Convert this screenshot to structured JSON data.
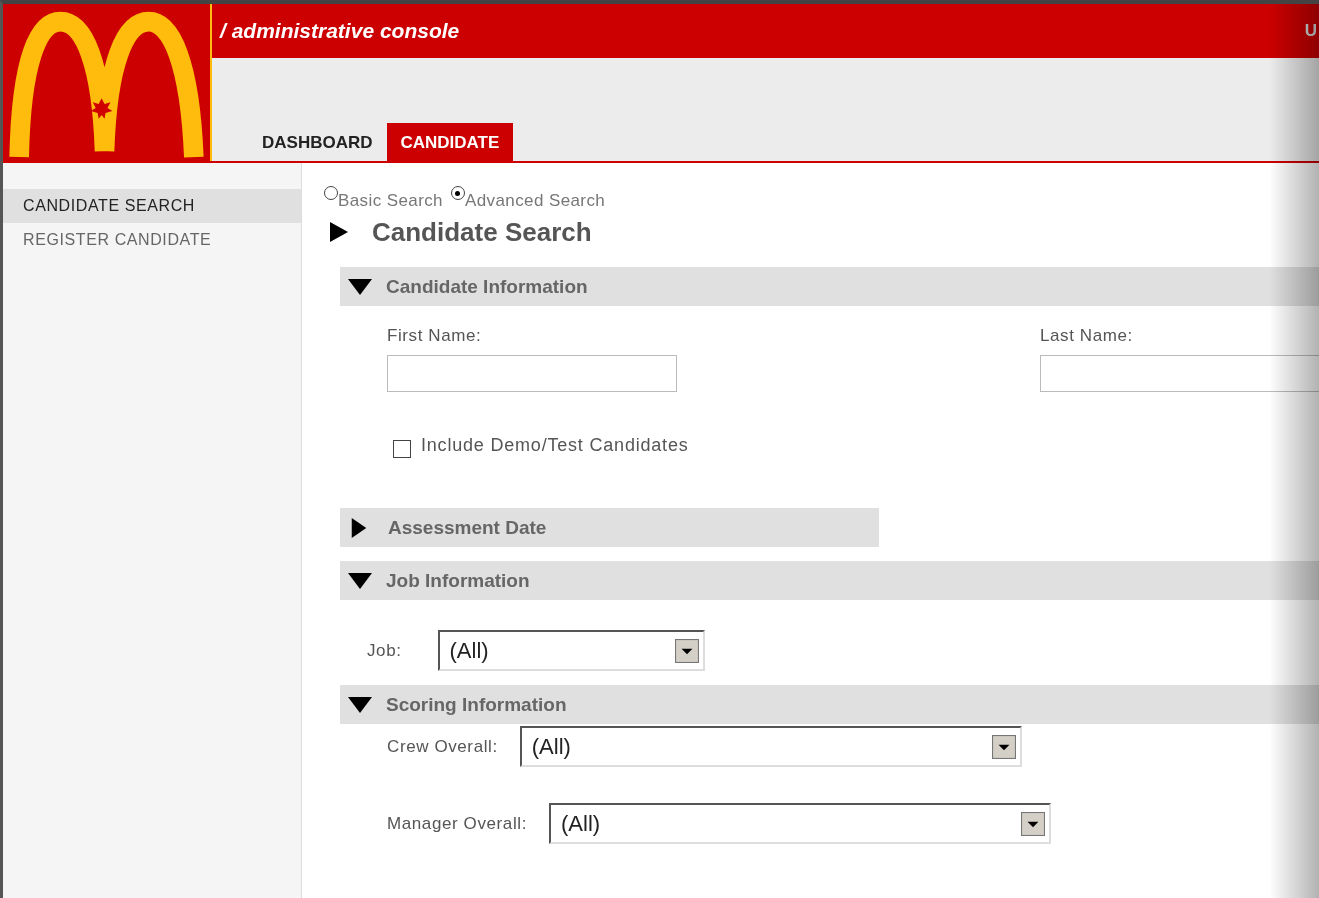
{
  "header": {
    "title": "/ administrative console",
    "user_text": "U"
  },
  "tabs": [
    {
      "label": "DASHBOARD",
      "selected": false
    },
    {
      "label": "CANDIDATE",
      "selected": true
    }
  ],
  "sidebar": {
    "items": [
      {
        "label": "CANDIDATE SEARCH",
        "selected": true
      },
      {
        "label": "REGISTER CANDIDATE",
        "selected": false
      }
    ]
  },
  "search_mode": [
    {
      "label": "Basic Search",
      "selected": false
    },
    {
      "label": "Advanced Search",
      "selected": true
    }
  ],
  "page_title": "Candidate Search",
  "sections": [
    {
      "title": "Candidate Information",
      "expanded": true,
      "fields": [
        {
          "kind": "text",
          "label": "First Name:"
        },
        {
          "kind": "text",
          "label": "Last Name:"
        }
      ],
      "checkbox": {
        "label": "Include Demo/Test Candidates",
        "checked": false
      }
    },
    {
      "title": "Assessment Date",
      "expanded": false
    },
    {
      "title": "Job Information",
      "expanded": true,
      "fields": [
        {
          "kind": "select",
          "label": "Job:",
          "value": "(All)"
        }
      ]
    },
    {
      "title": "Scoring Information",
      "expanded": true,
      "fields": [
        {
          "kind": "select",
          "label": "Crew Overall:",
          "value": "(All)"
        },
        {
          "kind": "select",
          "label": "Manager Overall:",
          "value": "(All)"
        }
      ]
    }
  ]
}
